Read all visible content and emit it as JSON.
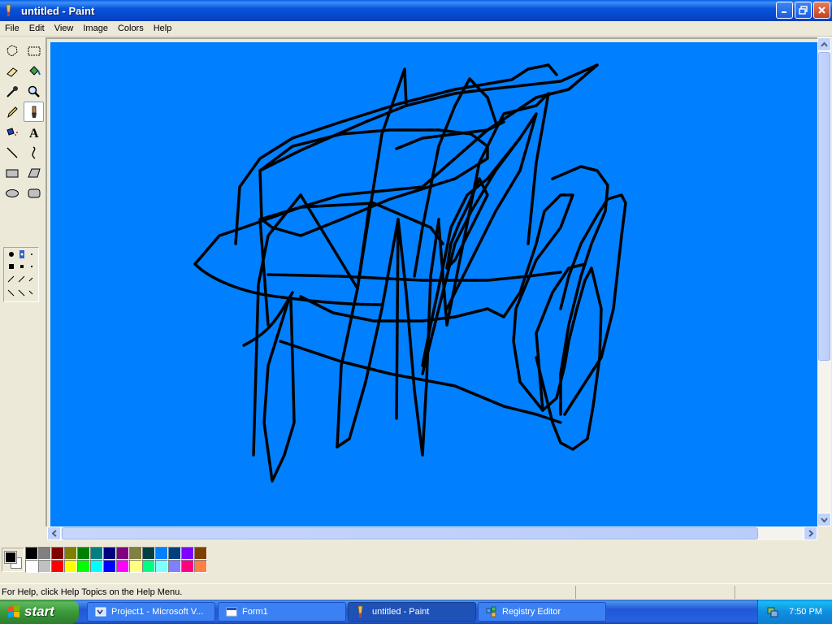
{
  "window": {
    "title": "untitled - Paint",
    "icon": "paint-icon"
  },
  "menu": [
    "File",
    "Edit",
    "View",
    "Image",
    "Colors",
    "Help"
  ],
  "tools": [
    {
      "name": "free-form-select-icon"
    },
    {
      "name": "rect-select-icon"
    },
    {
      "name": "eraser-icon"
    },
    {
      "name": "fill-icon"
    },
    {
      "name": "pick-color-icon"
    },
    {
      "name": "magnifier-icon"
    },
    {
      "name": "pencil-icon"
    },
    {
      "name": "brush-icon",
      "selected": true
    },
    {
      "name": "airbrush-icon"
    },
    {
      "name": "text-icon"
    },
    {
      "name": "line-icon"
    },
    {
      "name": "curve-icon"
    },
    {
      "name": "rectangle-icon"
    },
    {
      "name": "polygon-icon"
    },
    {
      "name": "ellipse-icon"
    },
    {
      "name": "rounded-rect-icon"
    }
  ],
  "canvas": {
    "background": "#0080FF",
    "stroke": "#000000"
  },
  "colors": {
    "foreground": "#000000",
    "background": "#FFFFFF",
    "palette_top": [
      "#000000",
      "#808080",
      "#800000",
      "#808000",
      "#008000",
      "#008080",
      "#000080",
      "#800080",
      "#808040",
      "#004040",
      "#0080FF",
      "#004080",
      "#8000FF",
      "#804000"
    ],
    "palette_bottom": [
      "#FFFFFF",
      "#C0C0C0",
      "#FF0000",
      "#FFFF00",
      "#00FF00",
      "#00FFFF",
      "#0000FF",
      "#FF00FF",
      "#FFFF80",
      "#00FF80",
      "#80FFFF",
      "#8080FF",
      "#FF0080",
      "#FF8040"
    ]
  },
  "status": {
    "help_text": "For Help, click Help Topics on the Help Menu."
  },
  "taskbar": {
    "start_label": "start",
    "tasks": [
      {
        "label": "Project1 - Microsoft V...",
        "icon": "vb-icon"
      },
      {
        "label": "Form1",
        "icon": "form-icon"
      },
      {
        "label": "untitled - Paint",
        "icon": "paint-icon",
        "active": true
      },
      {
        "label": "Registry Editor",
        "icon": "registry-icon"
      }
    ],
    "clock": "7:50 PM"
  }
}
